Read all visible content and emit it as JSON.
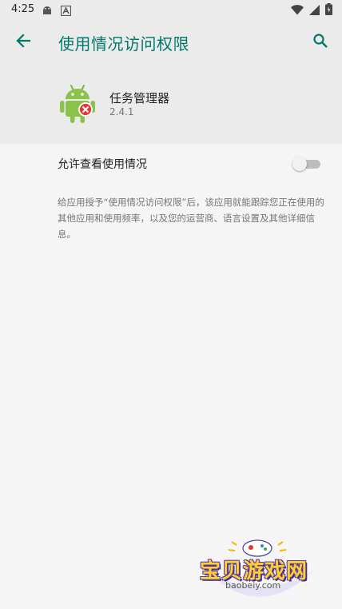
{
  "status_bar": {
    "time": "4:25",
    "left_icons": [
      "android-icon",
      "app-notification-icon"
    ],
    "right_icons": [
      "wifi-icon",
      "cell-signal-icon",
      "battery-icon"
    ]
  },
  "app_bar": {
    "title": "使用情况访问权限",
    "back_icon": "arrow-back-icon",
    "search_icon": "search-icon",
    "accent_color": "#00796b"
  },
  "app_info": {
    "name": "任务管理器",
    "version": "2.4.1",
    "icon": "android-robot-with-red-x-icon"
  },
  "setting": {
    "label": "允许查看使用情况",
    "toggle_on": false
  },
  "description": "给应用授予“使用情况访问权限”后，该应用就能跟踪您正在使用的其他应用和使用频率，以及您的运营商、语言设置及其他详细信息。",
  "watermark": {
    "logo_text": "宝贝游戏网",
    "url": "baobeiy.com"
  }
}
